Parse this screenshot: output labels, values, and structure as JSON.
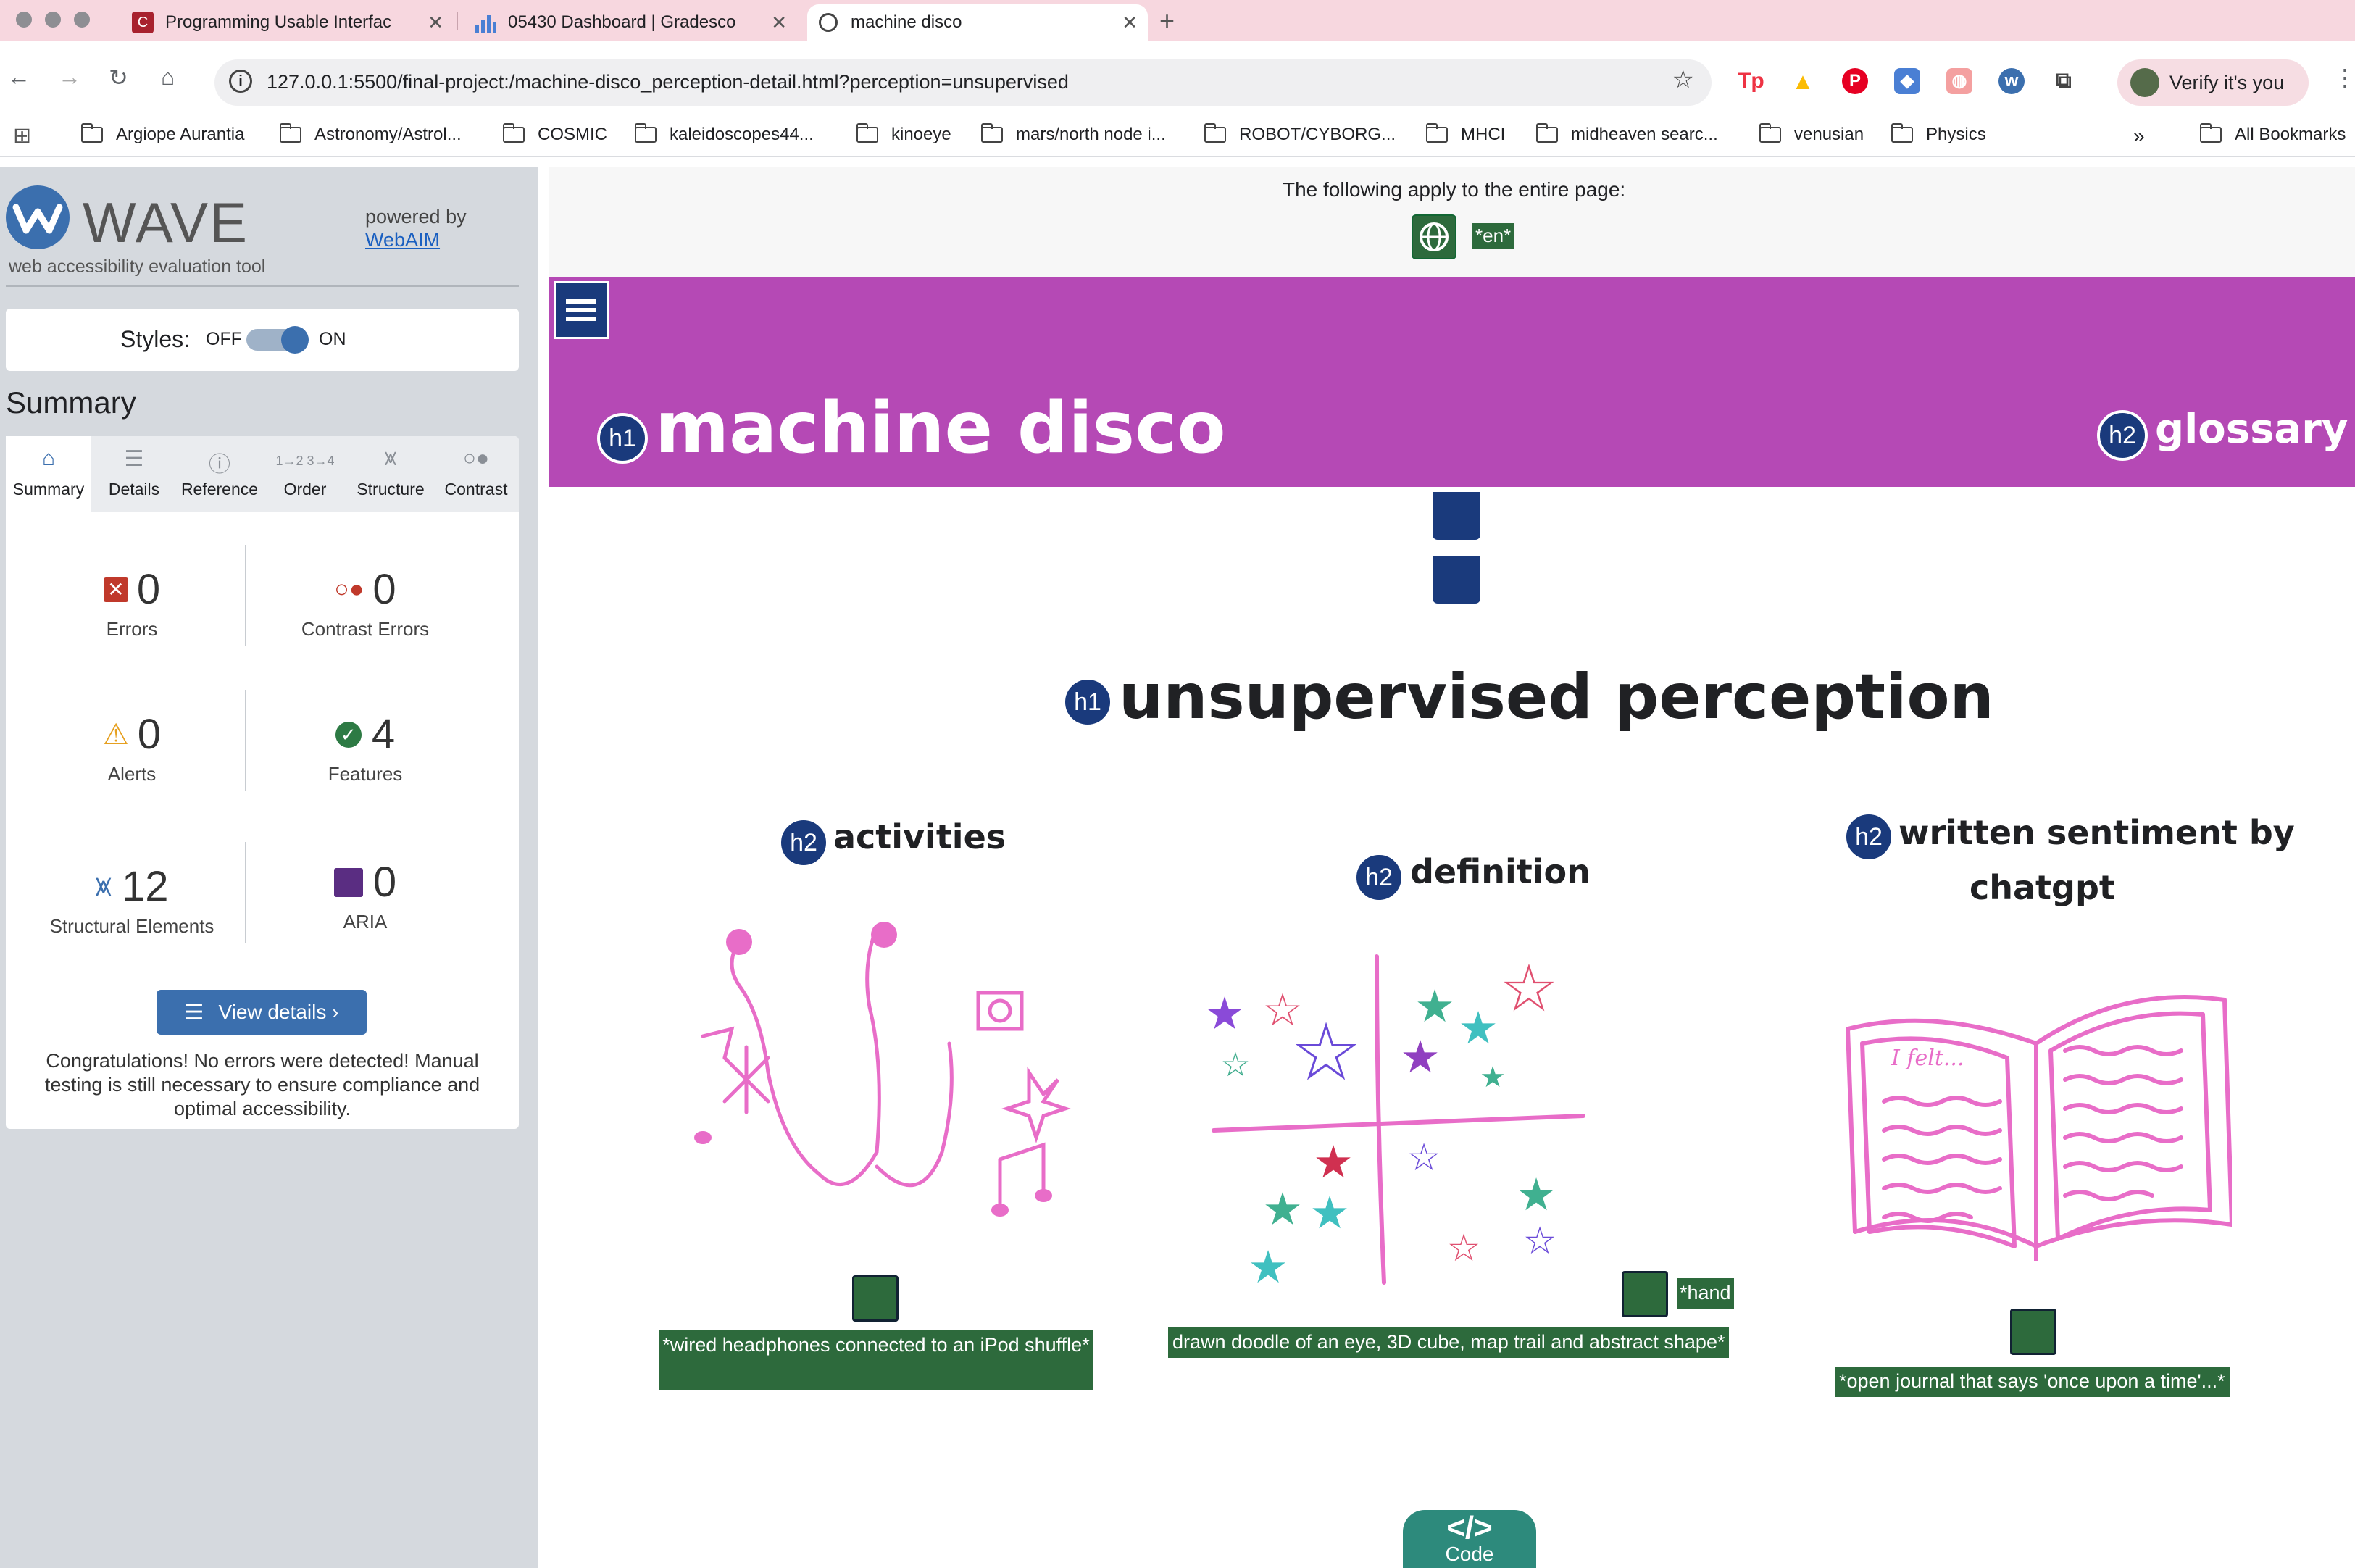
{
  "browser": {
    "tabs": [
      {
        "label": "Programming Usable Interfac",
        "icon": "canvas-icon",
        "active": false
      },
      {
        "label": "05430 Dashboard | Gradesco",
        "icon": "chart-icon",
        "active": false
      },
      {
        "label": "machine disco",
        "icon": "globe-icon",
        "active": true
      }
    ],
    "url": "127.0.0.1:5500/final-project:/machine-disco_perception-detail.html?perception=unsupervised",
    "profile_label": "Verify it's you",
    "bookmarks": [
      "Argiope Aurantia",
      "Astronomy/Astrol...",
      "COSMIC",
      "kaleidoscopes44...",
      "kinoeye",
      "mars/north node i...",
      "ROBOT/CYBORG...",
      "MHCI",
      "midheaven searc...",
      "venusian",
      "Physics"
    ],
    "all_bookmarks": "All Bookmarks"
  },
  "wave": {
    "title": "WAVE",
    "subtitle": "web accessibility evaluation tool",
    "powered_by": "powered by",
    "webaim": "WebAIM",
    "styles_label": "Styles:",
    "off": "OFF",
    "on": "ON",
    "summary_title": "Summary",
    "tabs": [
      "Summary",
      "Details",
      "Reference",
      "Order",
      "Structure",
      "Contrast"
    ],
    "stats": {
      "errors": {
        "value": "0",
        "label": "Errors"
      },
      "contrast": {
        "value": "0",
        "label": "Contrast Errors"
      },
      "alerts": {
        "value": "0",
        "label": "Alerts"
      },
      "features": {
        "value": "4",
        "label": "Features"
      },
      "structural": {
        "value": "12",
        "label": "Structural Elements"
      },
      "aria": {
        "value": "0",
        "label": "ARIA"
      }
    },
    "view_details": "View details ›",
    "congrats": "Congratulations! No errors were detected! Manual testing is still necessary to ensure compliance and optimal accessibility."
  },
  "page": {
    "apply_text": "The following apply to the entire page:",
    "lang_tag": "*en*",
    "site_title": "machine disco",
    "glossary": "glossary",
    "page_title": "unsupervised perception",
    "columns": {
      "activities": {
        "heading": "activities",
        "alt": "*wired headphones connected to an iPod shuffle*"
      },
      "definition": {
        "heading": "definition",
        "alt_a": "*hand",
        "alt_b": "drawn doodle of an eye, 3D cube, map trail and abstract shape*"
      },
      "sentiment": {
        "heading_a": "written sentiment by",
        "heading_b": "chatgpt",
        "alt": "*open journal that says 'once upon a time'...*",
        "journal_text": "I felt..."
      }
    },
    "code_label": "Code"
  },
  "colors": {
    "header": "#b549b5",
    "badge": "#1a3a7c",
    "alt_bg": "#2d6a3c",
    "doodle": "#e86dc8"
  }
}
